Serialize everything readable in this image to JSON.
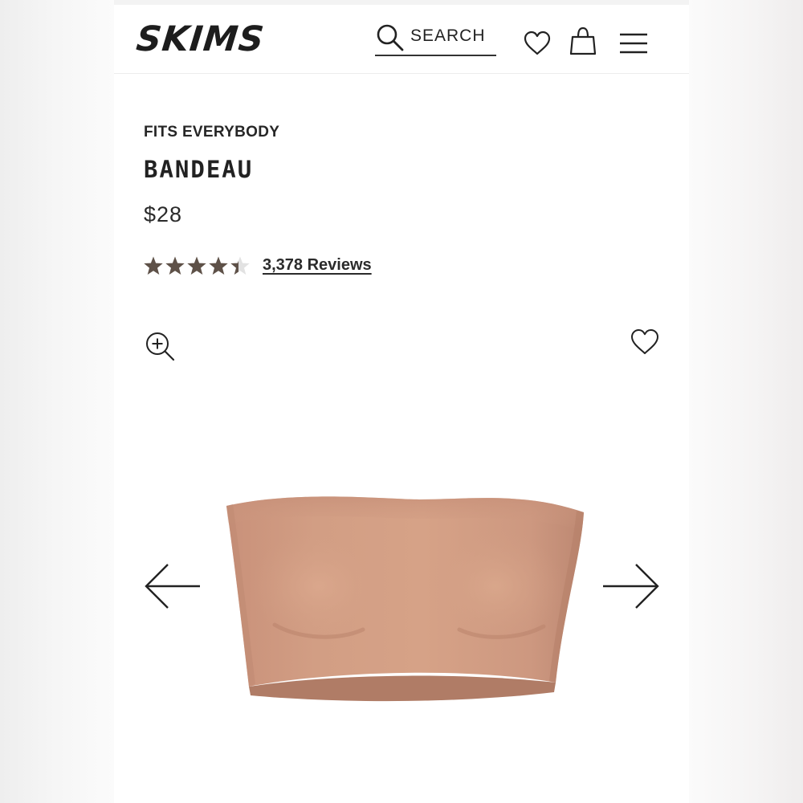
{
  "header": {
    "logo": "SKIMS",
    "search_label": "SEARCH",
    "icons": [
      "search-icon",
      "heart-icon",
      "shopping-bag-icon",
      "menu-icon"
    ]
  },
  "product": {
    "collection": "FITS EVERYBODY",
    "name": "BANDEAU",
    "price": "$28",
    "rating": 4.5,
    "rating_max": 5,
    "reviews_label": "3,378 Reviews"
  },
  "gallery": {
    "icons": [
      "zoom-in-icon",
      "favorite-heart-icon",
      "arrow-left-icon",
      "arrow-right-icon"
    ]
  },
  "colors": {
    "star_filled": "#5e5148",
    "star_empty": "#e2e2e2",
    "product_tone": "#cf9b80",
    "text": "#222222"
  }
}
